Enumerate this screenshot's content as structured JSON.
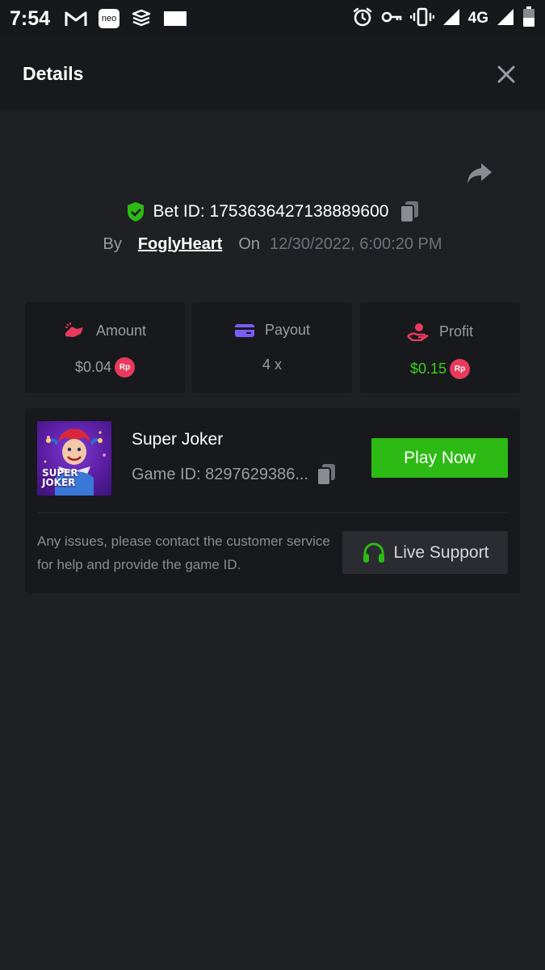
{
  "status_bar": {
    "time": "7:54",
    "icons": [
      "gmail-icon",
      "neo-icon",
      "app-icon",
      "square-icon",
      "alarm-icon",
      "key-icon",
      "vibrate-icon",
      "signal-icon",
      "signal-icon",
      "battery-icon"
    ],
    "neo_label": "neo",
    "network": "4G"
  },
  "header": {
    "title": "Details",
    "close_icon": "close-icon"
  },
  "bet": {
    "share_icon": "share-icon",
    "verified_icon": "shield-check-icon",
    "bet_id_label": "Bet ID: 1753636427138889600",
    "by_label": "By",
    "username": "FoglyHeart",
    "on_label": "On",
    "date": "12/30/2022, 6:00:20 PM"
  },
  "stats": {
    "amount": {
      "label": "Amount",
      "value": "$0.04",
      "badge": "Rp",
      "icon": "hand-money-icon"
    },
    "payout": {
      "label": "Payout",
      "value": "4 x",
      "icon": "card-icon"
    },
    "profit": {
      "label": "Profit",
      "value": "$0.15",
      "badge": "Rp",
      "icon": "profit-hand-icon"
    }
  },
  "game": {
    "thumb_text_1": "SUPER",
    "thumb_text_2": "JOKER",
    "title": "Super Joker",
    "game_id": "Game ID: 8297629386...",
    "play_label": "Play Now",
    "help_text": "Any issues, please contact the customer service for help and provide the game ID.",
    "support_label": "Live Support"
  },
  "colors": {
    "background": "#1f2024",
    "card": "#18191c",
    "accent_green": "#2eba15",
    "profit_green": "#3bd11c",
    "badge_red": "#e83a5d",
    "payout_purple": "#7b5cf6"
  }
}
